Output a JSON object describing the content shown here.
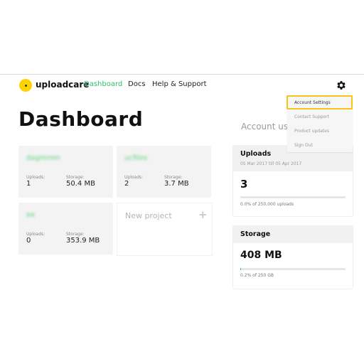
{
  "nav": {
    "brand": "uploadcare",
    "links": [
      "Dashboard",
      "Docs",
      "Help & Support"
    ],
    "active": "Dashboard"
  },
  "page": {
    "title": "Dashboard"
  },
  "projects": [
    {
      "name": "dagmmm",
      "uploads_label": "Uploads:",
      "uploads": "1",
      "storage_label": "Storage:",
      "storage": "50.4 MB"
    },
    {
      "name": "ucfiles",
      "uploads_label": "Uploads:",
      "uploads": "2",
      "storage_label": "Storage:",
      "storage": "3.7 MB"
    },
    {
      "name": "ee",
      "uploads_label": "Uploads:",
      "uploads": "0",
      "storage_label": "Storage:",
      "storage": "353.9 MB"
    }
  ],
  "new_project": {
    "label": "New project",
    "icon": "plus-icon"
  },
  "account": {
    "title": "Account usa"
  },
  "uploads_panel": {
    "title": "Uploads",
    "period": "05 Mar 2017 till 05 Apr 2017",
    "value": "3",
    "caption": "0.0% of 250,000 uploads",
    "fraction": 0.0
  },
  "storage_panel": {
    "title": "Storage",
    "value": "408 MB",
    "caption": "0.2% of 250 GB",
    "fraction": 0.002
  },
  "menu": {
    "items": [
      "Account Settings",
      "Contact Support",
      "Product updates",
      "Sign Out"
    ],
    "selected": "Account Settings"
  },
  "colors": {
    "accent": "#2fbf6e",
    "brand": "#ffd400",
    "highlight": "#f5c518"
  }
}
